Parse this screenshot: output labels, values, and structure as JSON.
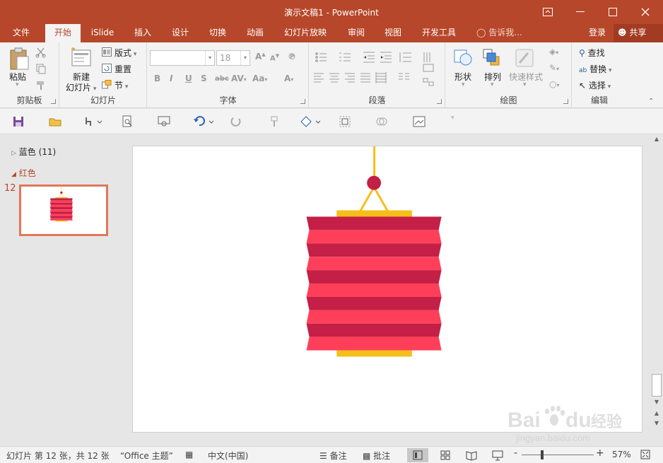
{
  "window": {
    "title": "演示文稿1 - PowerPoint",
    "ribbon_display_icon": "ribbon-display-icon",
    "minimize_icon": "minimize-icon",
    "maximize_icon": "maximize-icon",
    "close_icon": "close-icon"
  },
  "tabs": {
    "file": "文件",
    "home": "开始",
    "islide": "iSlide",
    "insert": "插入",
    "design": "设计",
    "transitions": "切换",
    "animations": "动画",
    "slideshow": "幻灯片放映",
    "review": "审阅",
    "view": "视图",
    "developer": "开发工具",
    "tell_me": "告诉我...",
    "login": "登录",
    "share": "共享"
  },
  "ribbon": {
    "clipboard": {
      "paste": "粘贴",
      "label": "剪贴板"
    },
    "slides": {
      "new_slide_line1": "新建",
      "new_slide_line2": "幻灯片",
      "layout": "版式",
      "reset": "重置",
      "section": "节",
      "label": "幻灯片"
    },
    "font": {
      "font_name": "",
      "font_size": "18",
      "label": "字体"
    },
    "paragraph": {
      "label": "段落"
    },
    "drawing": {
      "shapes": "形状",
      "arrange": "排列",
      "quick_styles": "快速样式",
      "label": "绘图"
    },
    "editing": {
      "find": "查找",
      "replace": "替换",
      "select": "选择",
      "label": "编辑"
    }
  },
  "panel": {
    "section_blue": "蓝色 (11)",
    "section_red": "红色",
    "slide_number": "12"
  },
  "status": {
    "slide_info": "幻灯片 第 12 张，共 12 张",
    "theme": "“Office 主题”",
    "language": "中文(中国)",
    "notes": "备注",
    "comments": "批注",
    "zoom_minus": "-",
    "zoom_plus": "+",
    "zoom_level": "57%"
  },
  "watermark": {
    "brand": "Bai du 经验",
    "url": "jingyan.baidu.com"
  },
  "colors": {
    "accent": "#b7472a",
    "lantern_dark": "#c41f46",
    "lantern_light": "#ff3f5a",
    "lantern_gold": "#f5bf1a",
    "lantern_knob": "#c41f46"
  }
}
